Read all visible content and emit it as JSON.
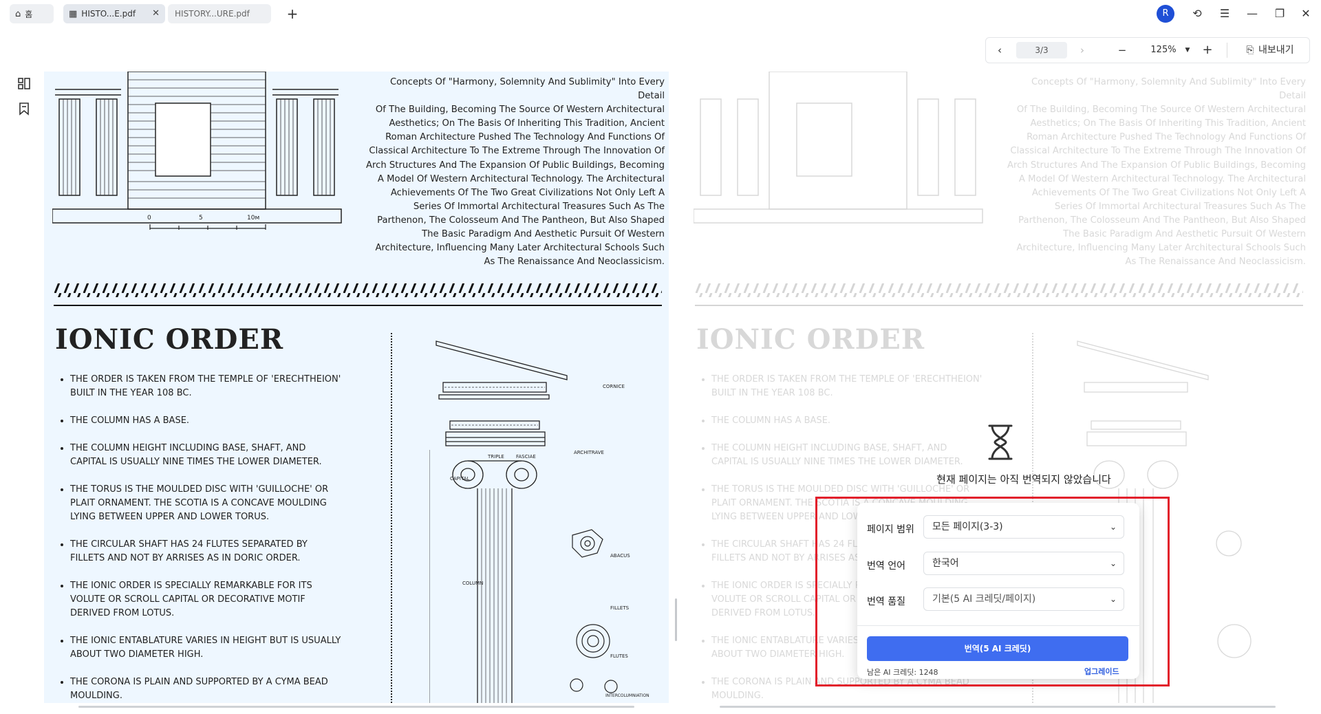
{
  "tabs": [
    {
      "label": "홈"
    },
    {
      "label": "HISTO...E.pdf"
    },
    {
      "label": "HISTORY...URE.pdf"
    }
  ],
  "window": {
    "avatar": "R"
  },
  "toolbar": {
    "page": "3/3",
    "zoom": "125%",
    "export_label": "내보내기"
  },
  "doc": {
    "paragraph": [
      "Concepts Of \"Harmony, Solemnity And Sublimity\" Into Every Detail",
      "Of The Building, Becoming The Source Of Western Architectural",
      "Aesthetics; On The Basis Of Inheriting This Tradition, Ancient",
      "Roman Architecture Pushed The Technology And Functions Of",
      "Classical Architecture To The Extreme Through The Innovation Of",
      "Arch Structures And The Expansion Of Public Buildings, Becoming",
      "A Model Of Western Architectural Technology. The Architectural",
      "Achievements Of The Two Great Civilizations Not Only Left A",
      "Series Of Immortal Architectural Treasures Such As The",
      "Parthenon, The Colosseum And The Pantheon, But Also Shaped",
      "The Basic Paradigm And Aesthetic Pursuit Of Western",
      "Architecture, Influencing Many Later Architectural Schools Such",
      "As The Renaissance And Neoclassicism."
    ],
    "scale_labels": [
      "0",
      "5",
      "10м"
    ],
    "heading": "IONIC ORDER",
    "bullets": [
      "THE ORDER IS TAKEN FROM THE TEMPLE OF 'ERECHTHEION' BUILT IN THE YEAR 108 BC.",
      "THE COLUMN HAS A BASE.",
      "THE COLUMN HEIGHT INCLUDING BASE, SHAFT, AND CAPITAL IS USUALLY NINE TIMES THE LOWER DIAMETER.",
      "THE TORUS IS THE MOULDED DISC WITH 'GUILLOCHE' OR PLAIT ORNAMENT. THE SCOTIA IS A CONCAVE MOULDING LYING BETWEEN UPPER AND LOWER TORUS.",
      "THE CIRCULAR SHAFT HAS 24 FLUTES SEPARATED BY FILLETS AND NOT BY ARRISES AS IN DORIC ORDER.",
      "THE IONIC ORDER IS SPECIALLY REMARKABLE FOR ITS VOLUTE OR SCROLL CAPITAL OR DECORATIVE MOTIF DERIVED FROM LOTUS.",
      "THE IONIC ENTABLATURE VARIES IN HEIGHT BUT IS USUALLY ABOUT TWO DIAMETER HIGH.",
      "THE CORONA IS PLAIN AND SUPPORTED BY A CYMA BEAD MOULDING."
    ],
    "diagram_labels": {
      "cornice": "CORNICE",
      "architrave": "ARCHITRAVE",
      "triple": "TRIPLE",
      "fasciae": "FASCIAE",
      "capital": "CAPITAL",
      "column": "COLUMN",
      "abacus": "ABACUS",
      "fillets": "FILLETS",
      "flutes": "FLUTES",
      "intercol": "INTERCOLUMNIATION"
    }
  },
  "translate": {
    "notice": "현재 페이지는 아직 번역되지 않았습니다",
    "range_label": "페이지 범위",
    "range_value": "모든 페이지(3-3)",
    "lang_label": "번역 언어",
    "lang_value": "한국어",
    "quality_label": "번역 품질",
    "quality_value": "기본(5 AI 크레딧/페이지)",
    "button": "번역(5 AI 크레딧)",
    "credits": "남은 AI 크레딧: 1248",
    "upgrade": "업그레이드"
  },
  "colors": {
    "accent": "#3f6df0",
    "highlight": "#e21d2b",
    "page_tint": "#eef7ff"
  }
}
